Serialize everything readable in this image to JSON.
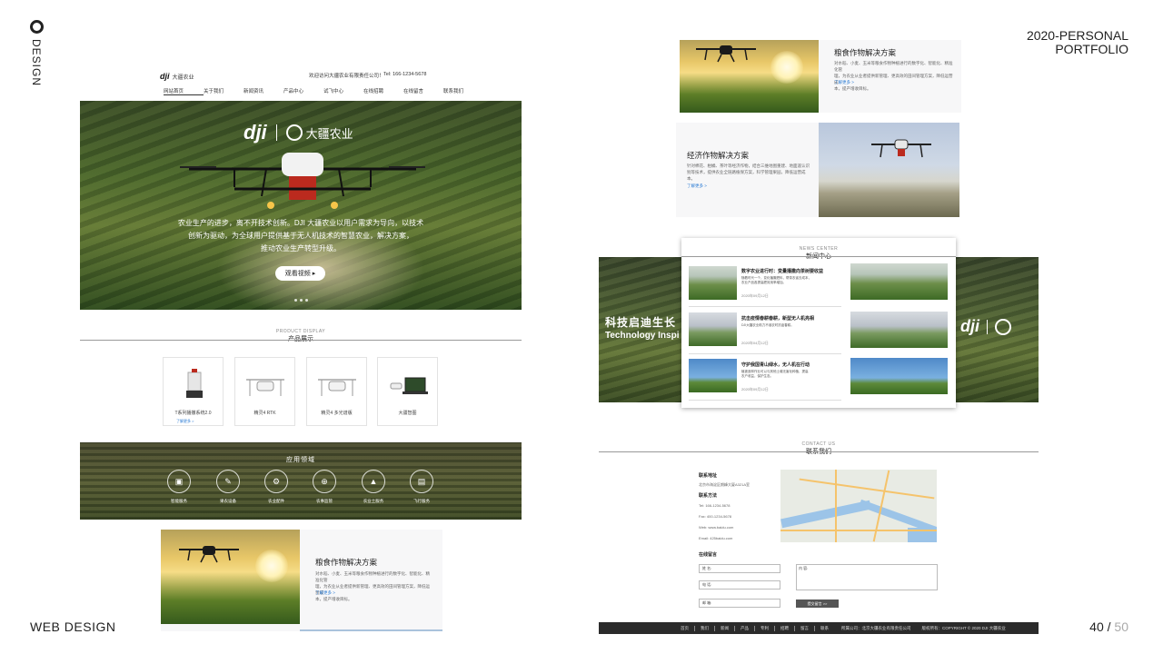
{
  "frame": {
    "vertical_label": "DESIGN",
    "portfolio_line1": "2020-PERSONAL",
    "portfolio_line2": "PORTFOLIO",
    "bottom_left": "WEB DESIGN",
    "page_current": "40",
    "page_sep": " / ",
    "page_total": "50"
  },
  "site": {
    "logo": "dji",
    "logo_sub": "大疆农业",
    "welcome": "欢迎访问大疆农业有限责任公司！",
    "tel": "Tel: 166-1234-5678",
    "nav": [
      "网站首页",
      "关于我们",
      "新闻资讯",
      "产品中心",
      "试飞中心",
      "在线招聘",
      "在线留言",
      "联系我们"
    ],
    "hero": {
      "logo_dji": "dji",
      "logo_cn": "大疆农业",
      "text_line1": "农业生产的进步，离不开技术创新。DJI 大疆农业以用户需求为导向，以技术",
      "text_line2": "创新为驱动，为全球用户提供基于无人机技术的智慧农业，解决方案，",
      "text_line3": "推动农业生产转型升级。",
      "button": "观看视频 ▸"
    },
    "products": {
      "en": "PRODUCT DISPLAY",
      "cn": "产品展示",
      "items": [
        {
          "label": "T系列播撒系统2.0",
          "more": "了解更多 >"
        },
        {
          "label": "精灵4 RTK"
        },
        {
          "label": "精灵4 多光谱版"
        },
        {
          "label": "大疆智图"
        }
      ]
    },
    "apps": {
      "title": "应用领域",
      "items": [
        {
          "label": "智能服务",
          "icon": "chip-icon",
          "glyph": "▣"
        },
        {
          "label": "果农设备",
          "icon": "document-icon",
          "glyph": "✎"
        },
        {
          "label": "农业配件",
          "icon": "gear-icon",
          "glyph": "⚙"
        },
        {
          "label": "农事监管",
          "icon": "target-icon",
          "glyph": "⊕"
        },
        {
          "label": "农业土服务",
          "icon": "mountain-icon",
          "glyph": "▲"
        },
        {
          "label": "飞行服务",
          "icon": "vehicle-icon",
          "glyph": "▤"
        }
      ]
    },
    "solution_grain": {
      "title": "粮食作物解决方案",
      "desc_1": "对水稻、小麦、玉米等粮食作物种植进行的数字化、智能化、精准化管",
      "desc_2": "理，为农业从业者提供新管理、更高效的田间管理方案，降低运营成",
      "desc_3": "本，提产增收目标。",
      "more": "了解更多 >"
    },
    "solution_econ": {
      "title": "经济作物解决方案",
      "desc_1": "针对棉花、柑橘、茶叶等经济作物，结合三维地图重建、地面遥认识",
      "desc_2": "别等技术，提供农业全链路植保方案，科学管理果园，降低运营成",
      "desc_3": "本。",
      "more": "了解更多 >"
    },
    "tech": {
      "cn": "科技启迪生长",
      "en": "Technology Inspi",
      "logo_dji": "dji"
    },
    "news": {
      "en": "NEWS CENTER",
      "cn": "新闻中心",
      "items": [
        {
          "title": "数字农业进行时：变量播撒向茶树要收益",
          "desc_1": "随着时代一个，变化播撒肥料，帮茶农省去成本，",
          "desc_2": "农业产品各提高肥效用率增加。",
          "date": "2020年09月12日"
        },
        {
          "title": "抗击疫情春耕春耕，新型无人机亮相",
          "desc_1": "DJI大疆农业助力不误农时抗疫春耕。",
          "desc_2": "",
          "date": "2020年04月12日"
        },
        {
          "title": "守护我国青山绿水，无人机在行动",
          "desc_1": "植被造林作业可以与其他土壤无害化种植、提高",
          "desc_2": "农户收益，保护生态。",
          "date": "2020年09月12日"
        }
      ]
    },
    "contact": {
      "en": "CONTACT US",
      "cn": "联系我们",
      "addr_label": "联系地址",
      "addr": "北京市海淀区朗峰大厦A321A室",
      "way_label": "联系方法",
      "tel": "Tel: 166-1234-5678",
      "fax": "Fax: 400-1234-5678",
      "web": "Web: www.baidu.com",
      "email": "Email: 425baidu.com",
      "msg_label": "在线留言",
      "name_field": "姓 名:",
      "content_field": "内 容:",
      "phone_field": "电 话:",
      "email_field": "邮 箱:",
      "submit": "提交留言 >>"
    },
    "footer": {
      "links": [
        "首页",
        "我们",
        "新闻",
        "产品",
        "专利",
        "招聘",
        "留言",
        "联系"
      ],
      "company": "所属公司：北京大疆农业有限责任公司",
      "copyright": "版权所有：COPYRIGHT © 2020 DJI 大疆农业"
    }
  }
}
